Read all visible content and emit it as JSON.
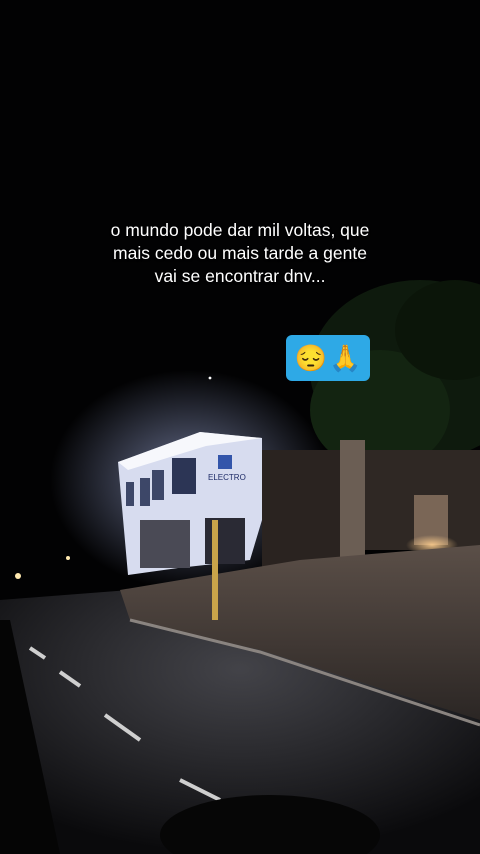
{
  "caption": {
    "lines": [
      "o mundo pode dar mil voltas, que",
      "mais cedo ou mais tarde a gente",
      "vai se encontrar dnv..."
    ]
  },
  "sticker": {
    "emojis": [
      "😔",
      "🙏"
    ],
    "background": "#2ea9e6"
  },
  "photo": {
    "building_sign": "ELECTRO"
  }
}
